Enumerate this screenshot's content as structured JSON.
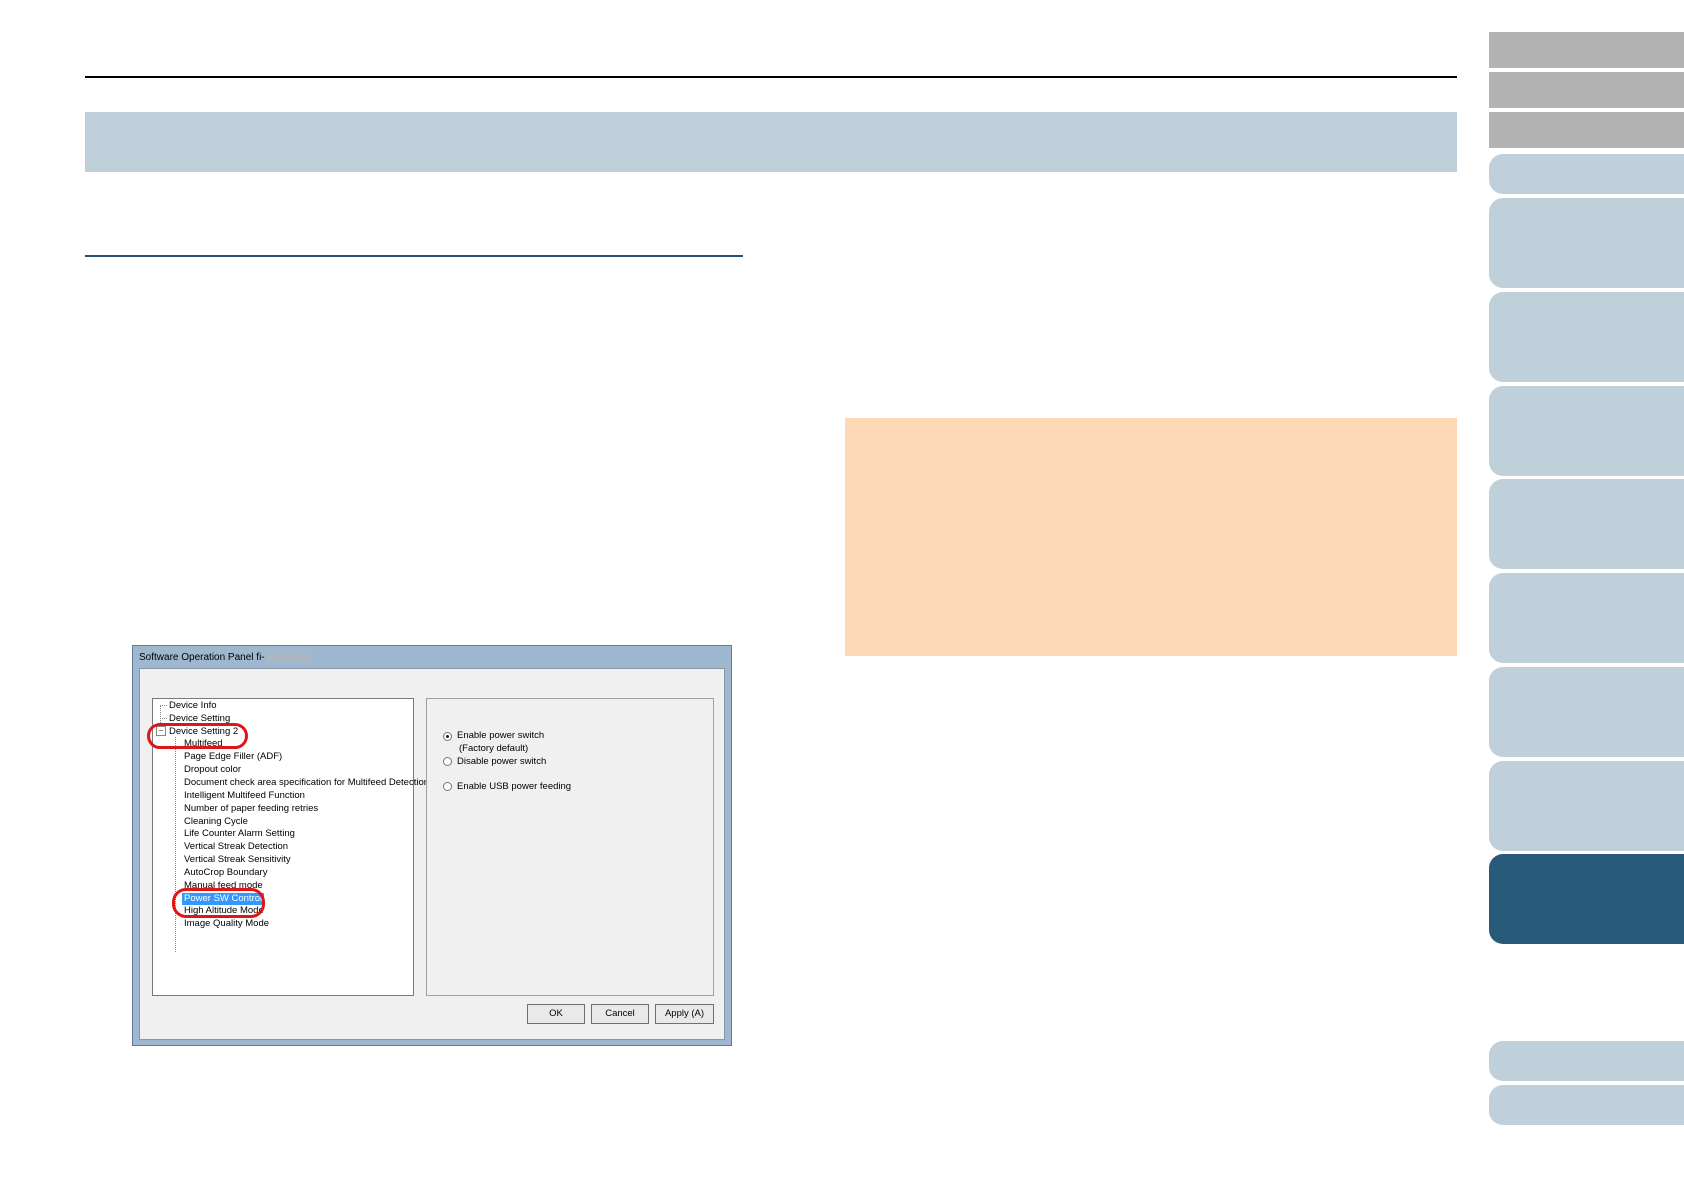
{
  "dialog": {
    "title": "Software Operation Panel fi-",
    "tree": {
      "items": [
        "Device Info",
        "Device Setting",
        "Device Setting 2",
        "Multifeed",
        "Page Edge Filler (ADF)",
        "Dropout color",
        "Document check area specification for Multifeed Detection",
        "Intelligent Multifeed Function",
        "Number of paper feeding retries",
        "Cleaning Cycle",
        "Life Counter Alarm Setting",
        "Vertical Streak Detection",
        "Vertical Streak Sensitivity",
        "AutoCrop Boundary",
        "Manual feed mode",
        "Power SW Control",
        "High Altitude Mode",
        "Image Quality Mode"
      ],
      "expander": "−"
    },
    "options": {
      "enable_power_switch": "Enable power switch",
      "factory_default": "(Factory default)",
      "disable_power_switch": "Disable power switch",
      "enable_usb_power_feeding": "Enable USB power feeding"
    },
    "buttons": {
      "ok": "OK",
      "cancel": "Cancel",
      "apply": "Apply (A)"
    }
  },
  "colors": {
    "header_band": "#c0d0da",
    "note_box": "#fdd9b8",
    "nav_active": "#285a7a",
    "nav_inactive": "#c0d0da",
    "nav_gray": "#b3b3b3",
    "highlight_ring": "#e01616",
    "tree_selection": "#3399ff"
  }
}
